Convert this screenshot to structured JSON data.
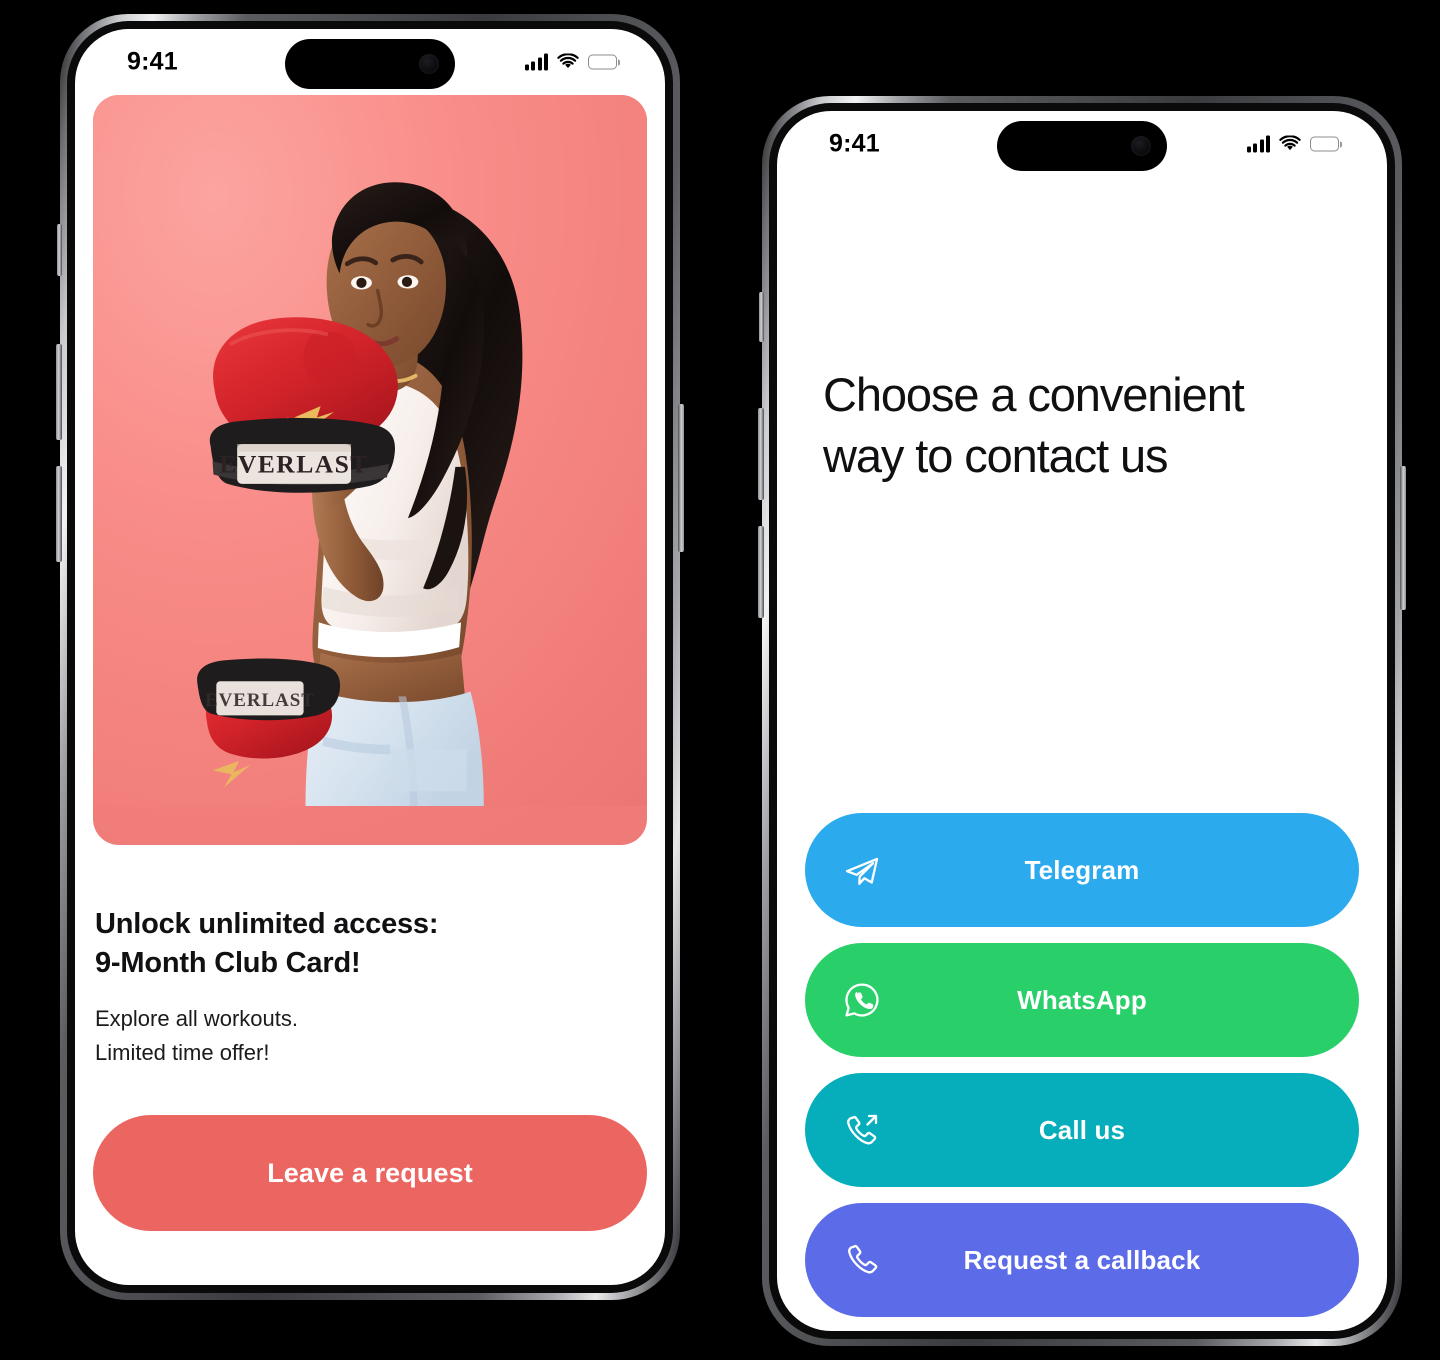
{
  "colors": {
    "page_background": "#000000",
    "screen_background": "#ffffff",
    "cta_red": "#EC6661",
    "telegram_blue": "#2BAAEE",
    "whatsapp_green": "#29CF69",
    "callus_teal": "#06AEBC",
    "callback_indigo": "#5C6BE8",
    "hero_pink": "#F4827E",
    "glove_red": "#D8232A",
    "heading_black": "#101012"
  },
  "left_phone": {
    "status_bar": {
      "time": "9:41",
      "signal_icon": "cellular-bars-icon",
      "wifi_icon": "wifi-icon",
      "battery_icon": "battery-icon"
    },
    "hero": {
      "alt": "Woman in white crop top wearing red Everlast boxing gloves on pink background",
      "glove_brand": "EVERLAST"
    },
    "promo": {
      "title_line1": "Unlock unlimited access:",
      "title_line2": "9-Month Club Card!",
      "subtitle_line1": "Explore all workouts.",
      "subtitle_line2": "Limited time offer!"
    },
    "cta": {
      "label": "Leave a request"
    }
  },
  "right_phone": {
    "status_bar": {
      "time": "9:41",
      "signal_icon": "cellular-bars-icon",
      "wifi_icon": "wifi-icon",
      "battery_icon": "battery-icon"
    },
    "title_line1": "Choose a convenient",
    "title_line2": "way to contact us",
    "contact_options": [
      {
        "label": "Telegram",
        "icon": "telegram-paper-plane-icon",
        "color": "#2BAAEE"
      },
      {
        "label": "WhatsApp",
        "icon": "whatsapp-icon",
        "color": "#29CF69"
      },
      {
        "label": "Call us",
        "icon": "phone-outgoing-icon",
        "color": "#06AEBC"
      },
      {
        "label": "Request a callback",
        "icon": "phone-handset-icon",
        "color": "#5C6BE8"
      }
    ]
  }
}
